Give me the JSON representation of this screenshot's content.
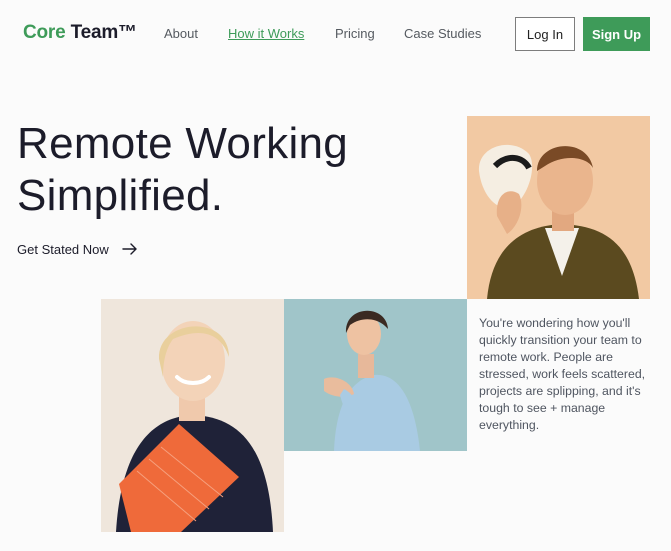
{
  "brand": {
    "core": "Core",
    "team": "Team™"
  },
  "nav": {
    "links": [
      {
        "label": "About",
        "active": false
      },
      {
        "label": "How it Works",
        "active": true
      },
      {
        "label": "Pricing",
        "active": false
      },
      {
        "label": "Case Studies",
        "active": false
      }
    ],
    "login_label": "Log In",
    "signup_label": "Sign Up"
  },
  "hero": {
    "headline_line1": "Remote Working",
    "headline_line2": "Simplified.",
    "cta_label": "Get Stated Now",
    "cta_icon": "arrow-right-icon"
  },
  "blurb": "You're wondering how you'll quickly transition your team to remote work. People are stressed, work feels scattered, projects are splipping, and it's tough to see + manage everything.",
  "colors": {
    "accent": "#3e9b59",
    "text": "#1c1c2a",
    "muted": "#555a60",
    "background": "#fbfbfb"
  }
}
